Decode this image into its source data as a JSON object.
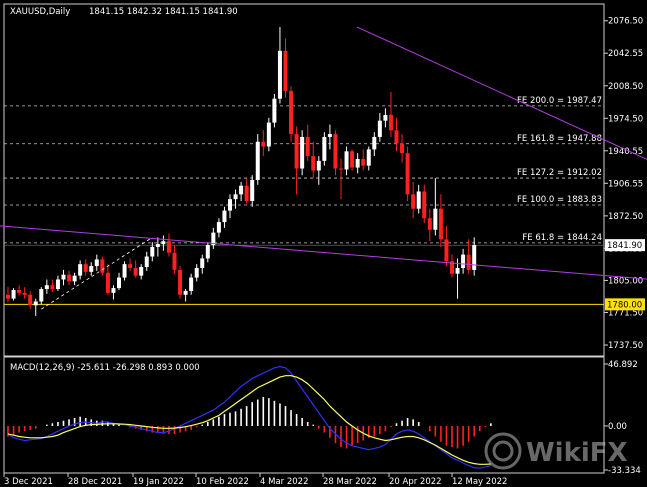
{
  "header": {
    "symbol": "XAUUSD,Daily",
    "ohlc": "1841.15 1842.32 1841.15 1841.90"
  },
  "macd": {
    "label": "MACD(12,26,9) -25.611 -26.298 0.893 0.000",
    "y_max": 46.892,
    "y_min": -33.334,
    "ticks": [
      {
        "v": 46.892,
        "t": "46.892"
      },
      {
        "v": 0.0,
        "t": "0.00"
      },
      {
        "v": -33.334,
        "t": "-33.334"
      }
    ]
  },
  "watermark": "WikiFX",
  "colors": {
    "bull": "#ffffff",
    "bear": "#ff2020",
    "trend": "#b040e0",
    "support": "#ffe000",
    "macd_line": "#3030ff",
    "signal_line": "#ffff60",
    "grid_dash": "#c8c8c8"
  },
  "chart_data": {
    "type": "candlestick",
    "price_axis": {
      "min": 1726,
      "max": 2094,
      "ticks": [
        "2076.50",
        "2042.55",
        "2008.50",
        "1974.50",
        "1940.55",
        "1906.55",
        "1872.50",
        "1838.55",
        "1805.00",
        "1771.50",
        "1737.50"
      ]
    },
    "current_price": "1841.90",
    "support_level": "1780.00",
    "x_labels": [
      "3 Dec 2021",
      "28 Dec 2021",
      "19 Jan 2022",
      "10 Feb 2022",
      "4 Mar 2022",
      "28 Mar 2022",
      "20 Apr 2022",
      "12 May 2022"
    ],
    "fib_extensions": [
      {
        "label": "FE 200.0 = 1987.47",
        "value": 1987.47
      },
      {
        "label": "FE 161.8 = 1947.88",
        "value": 1947.88
      },
      {
        "label": "FE 127.2 = 1912.02",
        "value": 1912.02
      },
      {
        "label": "FE 100.0 = 1883.83",
        "value": 1883.83
      },
      {
        "label": "FE 61.8 = 1844.24",
        "value": 1844.24
      }
    ],
    "upper_trendline": {
      "from_date": "1 Mar 2022",
      "from_price": 2070,
      "to_date": "1 Jun 2022",
      "to_price": 1896
    },
    "lower_trendline": {
      "from_date": "1 Dec 2021",
      "from_price": 1862,
      "to_date": "1 Jun 2022",
      "to_price": 1800
    },
    "ohlc": [
      [
        1790,
        1798,
        1782,
        1786
      ],
      [
        1786,
        1797,
        1784,
        1795
      ],
      [
        1795,
        1800,
        1789,
        1792
      ],
      [
        1792,
        1798,
        1786,
        1790
      ],
      [
        1790,
        1794,
        1775,
        1779
      ],
      [
        1779,
        1786,
        1768,
        1783
      ],
      [
        1783,
        1798,
        1780,
        1796
      ],
      [
        1796,
        1806,
        1791,
        1800
      ],
      [
        1800,
        1806,
        1793,
        1796
      ],
      [
        1796,
        1810,
        1794,
        1806
      ],
      [
        1806,
        1816,
        1800,
        1811
      ],
      [
        1811,
        1815,
        1800,
        1804
      ],
      [
        1804,
        1813,
        1800,
        1810
      ],
      [
        1810,
        1826,
        1806,
        1822
      ],
      [
        1822,
        1827,
        1810,
        1814
      ],
      [
        1814,
        1824,
        1810,
        1820
      ],
      [
        1820,
        1832,
        1815,
        1827
      ],
      [
        1827,
        1830,
        1810,
        1813
      ],
      [
        1813,
        1822,
        1790,
        1792
      ],
      [
        1792,
        1800,
        1785,
        1797
      ],
      [
        1797,
        1813,
        1795,
        1808
      ],
      [
        1808,
        1825,
        1805,
        1822
      ],
      [
        1822,
        1828,
        1815,
        1818
      ],
      [
        1818,
        1826,
        1808,
        1810
      ],
      [
        1810,
        1822,
        1806,
        1819
      ],
      [
        1819,
        1835,
        1815,
        1830
      ],
      [
        1830,
        1845,
        1825,
        1840
      ],
      [
        1840,
        1850,
        1830,
        1843
      ],
      [
        1843,
        1852,
        1836,
        1846
      ],
      [
        1846,
        1854,
        1830,
        1834
      ],
      [
        1834,
        1842,
        1812,
        1816
      ],
      [
        1816,
        1820,
        1786,
        1790
      ],
      [
        1790,
        1796,
        1783,
        1794
      ],
      [
        1794,
        1812,
        1790,
        1808
      ],
      [
        1808,
        1822,
        1804,
        1818
      ],
      [
        1818,
        1832,
        1812,
        1828
      ],
      [
        1828,
        1845,
        1824,
        1842
      ],
      [
        1842,
        1860,
        1838,
        1855
      ],
      [
        1855,
        1870,
        1850,
        1866
      ],
      [
        1866,
        1882,
        1860,
        1878
      ],
      [
        1878,
        1895,
        1870,
        1890
      ],
      [
        1890,
        1900,
        1880,
        1895
      ],
      [
        1895,
        1908,
        1888,
        1904
      ],
      [
        1904,
        1912,
        1885,
        1888
      ],
      [
        1888,
        1915,
        1882,
        1910
      ],
      [
        1910,
        1958,
        1905,
        1950
      ],
      [
        1950,
        1962,
        1935,
        1945
      ],
      [
        1945,
        1975,
        1940,
        1970
      ],
      [
        1970,
        2000,
        1965,
        1995
      ],
      [
        1995,
        2070,
        1990,
        2045
      ],
      [
        2045,
        2058,
        1996,
        2003
      ],
      [
        2003,
        2008,
        1950,
        1958
      ],
      [
        1958,
        1966,
        1895,
        1922
      ],
      [
        1922,
        1962,
        1915,
        1955
      ],
      [
        1955,
        1968,
        1930,
        1935
      ],
      [
        1935,
        1950,
        1912,
        1920
      ],
      [
        1920,
        1935,
        1905,
        1930
      ],
      [
        1930,
        1960,
        1925,
        1955
      ],
      [
        1955,
        1968,
        1942,
        1958
      ],
      [
        1958,
        1962,
        1915,
        1922
      ],
      [
        1922,
        1932,
        1890,
        1921
      ],
      [
        1921,
        1945,
        1915,
        1940
      ],
      [
        1940,
        1942,
        1920,
        1923
      ],
      [
        1923,
        1938,
        1917,
        1932
      ],
      [
        1932,
        1942,
        1920,
        1925
      ],
      [
        1925,
        1945,
        1920,
        1942
      ],
      [
        1942,
        1960,
        1935,
        1955
      ],
      [
        1955,
        1980,
        1950,
        1972
      ],
      [
        1972,
        1985,
        1965,
        1978
      ],
      [
        1978,
        2002,
        1955,
        1962
      ],
      [
        1962,
        1975,
        1940,
        1948
      ],
      [
        1948,
        1958,
        1928,
        1938
      ],
      [
        1938,
        1945,
        1888,
        1895
      ],
      [
        1895,
        1908,
        1870,
        1880
      ],
      [
        1880,
        1905,
        1875,
        1898
      ],
      [
        1898,
        1905,
        1865,
        1870
      ],
      [
        1870,
        1880,
        1846,
        1858
      ],
      [
        1858,
        1912,
        1852,
        1880
      ],
      [
        1880,
        1895,
        1840,
        1848
      ],
      [
        1848,
        1862,
        1820,
        1825
      ],
      [
        1825,
        1832,
        1808,
        1812
      ],
      [
        1812,
        1828,
        1786,
        1818
      ],
      [
        1818,
        1838,
        1812,
        1832
      ],
      [
        1832,
        1848,
        1812,
        1816
      ],
      [
        1816,
        1850,
        1810,
        1841.9
      ]
    ],
    "macd_histogram": [
      -8,
      -7,
      -5,
      -4,
      -3,
      -2,
      0,
      1,
      2,
      3,
      4,
      5,
      6,
      7,
      6,
      5,
      4,
      4,
      3,
      2,
      1,
      0,
      -1,
      -2,
      -3,
      -4,
      -5,
      -5,
      -6,
      -6,
      -6,
      -5,
      -4,
      -3,
      -1,
      1,
      3,
      5,
      7,
      9,
      10,
      11,
      13,
      15,
      18,
      20,
      22,
      21,
      19,
      17,
      15,
      12,
      9,
      6,
      3,
      1,
      -2,
      -5,
      -9,
      -13,
      -16,
      -17,
      -15,
      -13,
      -11,
      -9,
      -8,
      -6,
      -4,
      -1,
      2,
      4,
      6,
      5,
      3,
      0,
      -4,
      -8,
      -12,
      -15,
      -16,
      -17,
      -15,
      -12,
      -8,
      -4,
      -1,
      2
    ],
    "macd_line": [
      -6,
      -9,
      -10,
      -11,
      -10.5,
      -10,
      -9.5,
      -8,
      -6,
      -4,
      -2,
      0,
      1.5,
      2.5,
      3,
      2.5,
      2,
      3,
      3,
      2,
      1.5,
      1,
      0,
      -1,
      -2,
      -3,
      -4,
      -5,
      -5,
      -4,
      -2,
      0,
      2,
      4,
      6,
      8,
      10,
      12,
      15,
      18,
      22,
      26,
      30,
      33,
      36,
      38,
      40,
      42,
      44,
      45,
      44,
      40,
      34,
      28,
      22,
      16,
      10,
      4,
      -2,
      -6,
      -10,
      -13,
      -15,
      -16,
      -17,
      -18,
      -17,
      -16,
      -14,
      -10,
      -6,
      -4,
      -3,
      -4,
      -6,
      -9,
      -12,
      -15,
      -18,
      -21,
      -24,
      -26,
      -28,
      -30,
      -31.5,
      -32,
      -31,
      -30
    ],
    "signal_line": [
      -6,
      -7,
      -8,
      -8.5,
      -9,
      -9,
      -9,
      -8.5,
      -8,
      -7,
      -5,
      -3.5,
      -2,
      -0.5,
      0.5,
      1,
      1.2,
      1.5,
      1.6,
      1.6,
      1.5,
      1.3,
      1,
      0.5,
      0,
      -0.5,
      -1,
      -1.5,
      -1.8,
      -1.8,
      -1.6,
      -1.2,
      -0.6,
      0.3,
      1.3,
      2.5,
      4,
      6,
      8,
      11,
      14,
      17,
      20,
      23,
      26,
      29,
      31,
      33,
      35,
      37,
      38,
      38,
      37,
      35,
      32,
      28,
      24,
      20,
      15,
      11,
      7,
      3,
      0,
      -3,
      -5.5,
      -7.5,
      -9,
      -10,
      -11,
      -10.5,
      -9.5,
      -8.5,
      -8,
      -8,
      -9,
      -10.5,
      -12.5,
      -14.5,
      -17,
      -19.5,
      -22,
      -24,
      -26,
      -27.5,
      -28.5,
      -29,
      -29,
      -28.8
    ]
  }
}
